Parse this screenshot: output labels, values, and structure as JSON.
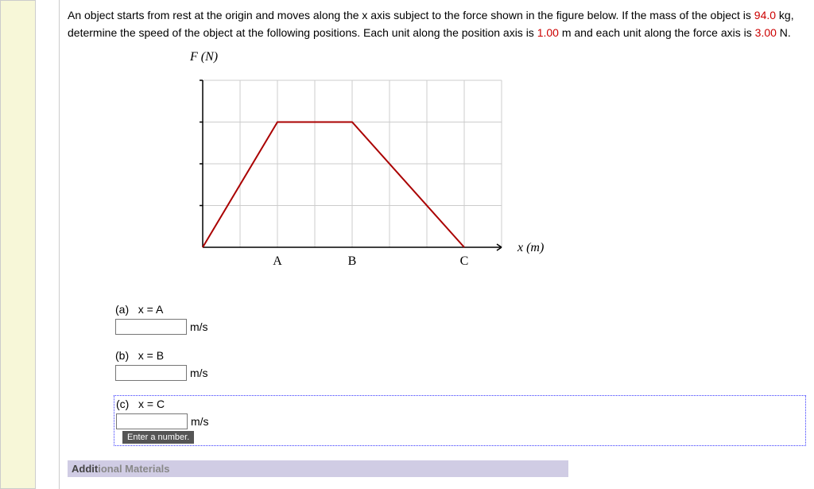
{
  "question": {
    "text_before_mass": "An object starts from rest at the origin and moves along the x axis subject to the force shown in the figure below. If the mass of the object is ",
    "mass_value": "94.0",
    "text_after_mass": " kg, determine the speed of the object at the following positions. Each unit along the position axis is ",
    "position_unit": "1.00",
    "text_mid": " m and each unit along the force axis is ",
    "force_unit": "3.00",
    "text_end": " N."
  },
  "figure": {
    "y_axis_label": "F (N)",
    "x_axis_label": "x (m)",
    "x_ticks": [
      "A",
      "B",
      "C"
    ]
  },
  "chart_data": {
    "type": "line",
    "title": "Force vs Position",
    "xlabel": "x (m)",
    "ylabel": "F (N)",
    "x": [
      0,
      2,
      4,
      7
    ],
    "y": [
      0,
      3,
      3,
      0
    ],
    "x_units_per_grid": 1.0,
    "y_units_per_grid": 3.0,
    "x_tick_labels": {
      "2": "A",
      "4": "B",
      "7": "C"
    },
    "xlim": [
      0,
      8
    ],
    "ylim": [
      0,
      4
    ]
  },
  "parts": [
    {
      "id": "a",
      "label": "(a)",
      "condition": "x = A",
      "unit": "m/s",
      "value": ""
    },
    {
      "id": "b",
      "label": "(b)",
      "condition": "x = B",
      "unit": "m/s",
      "value": ""
    },
    {
      "id": "c",
      "label": "(c)",
      "condition": "x = C",
      "unit": "m/s",
      "value": ""
    }
  ],
  "tooltip": "Enter a number.",
  "additional_materials": "Additional Materials"
}
